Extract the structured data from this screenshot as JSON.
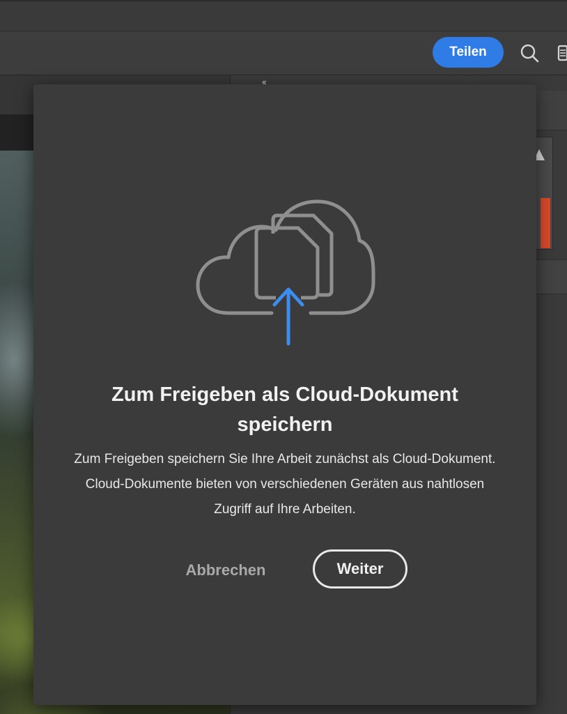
{
  "toolbar": {
    "share_label": "Teilen",
    "search_icon": "search-icon",
    "panel_icon": "panels-icon",
    "accent_color": "#2f7ce6"
  },
  "workspace": {
    "collapse_label": "‹‹"
  },
  "dialog": {
    "illustration_icon": "cloud-document-upload-icon",
    "title": "Zum Freigeben als Cloud-Dokument speichern",
    "body": "Zum Freigeben speichern Sie Ihre Arbeit zunächst als Cloud-Dokument. Cloud-Dokumente bieten von verschiedenen Geräten aus nahtlosen Zugriff auf Ihre Arbeiten.",
    "cancel_label": "Abbrechen",
    "continue_label": "Weiter"
  }
}
